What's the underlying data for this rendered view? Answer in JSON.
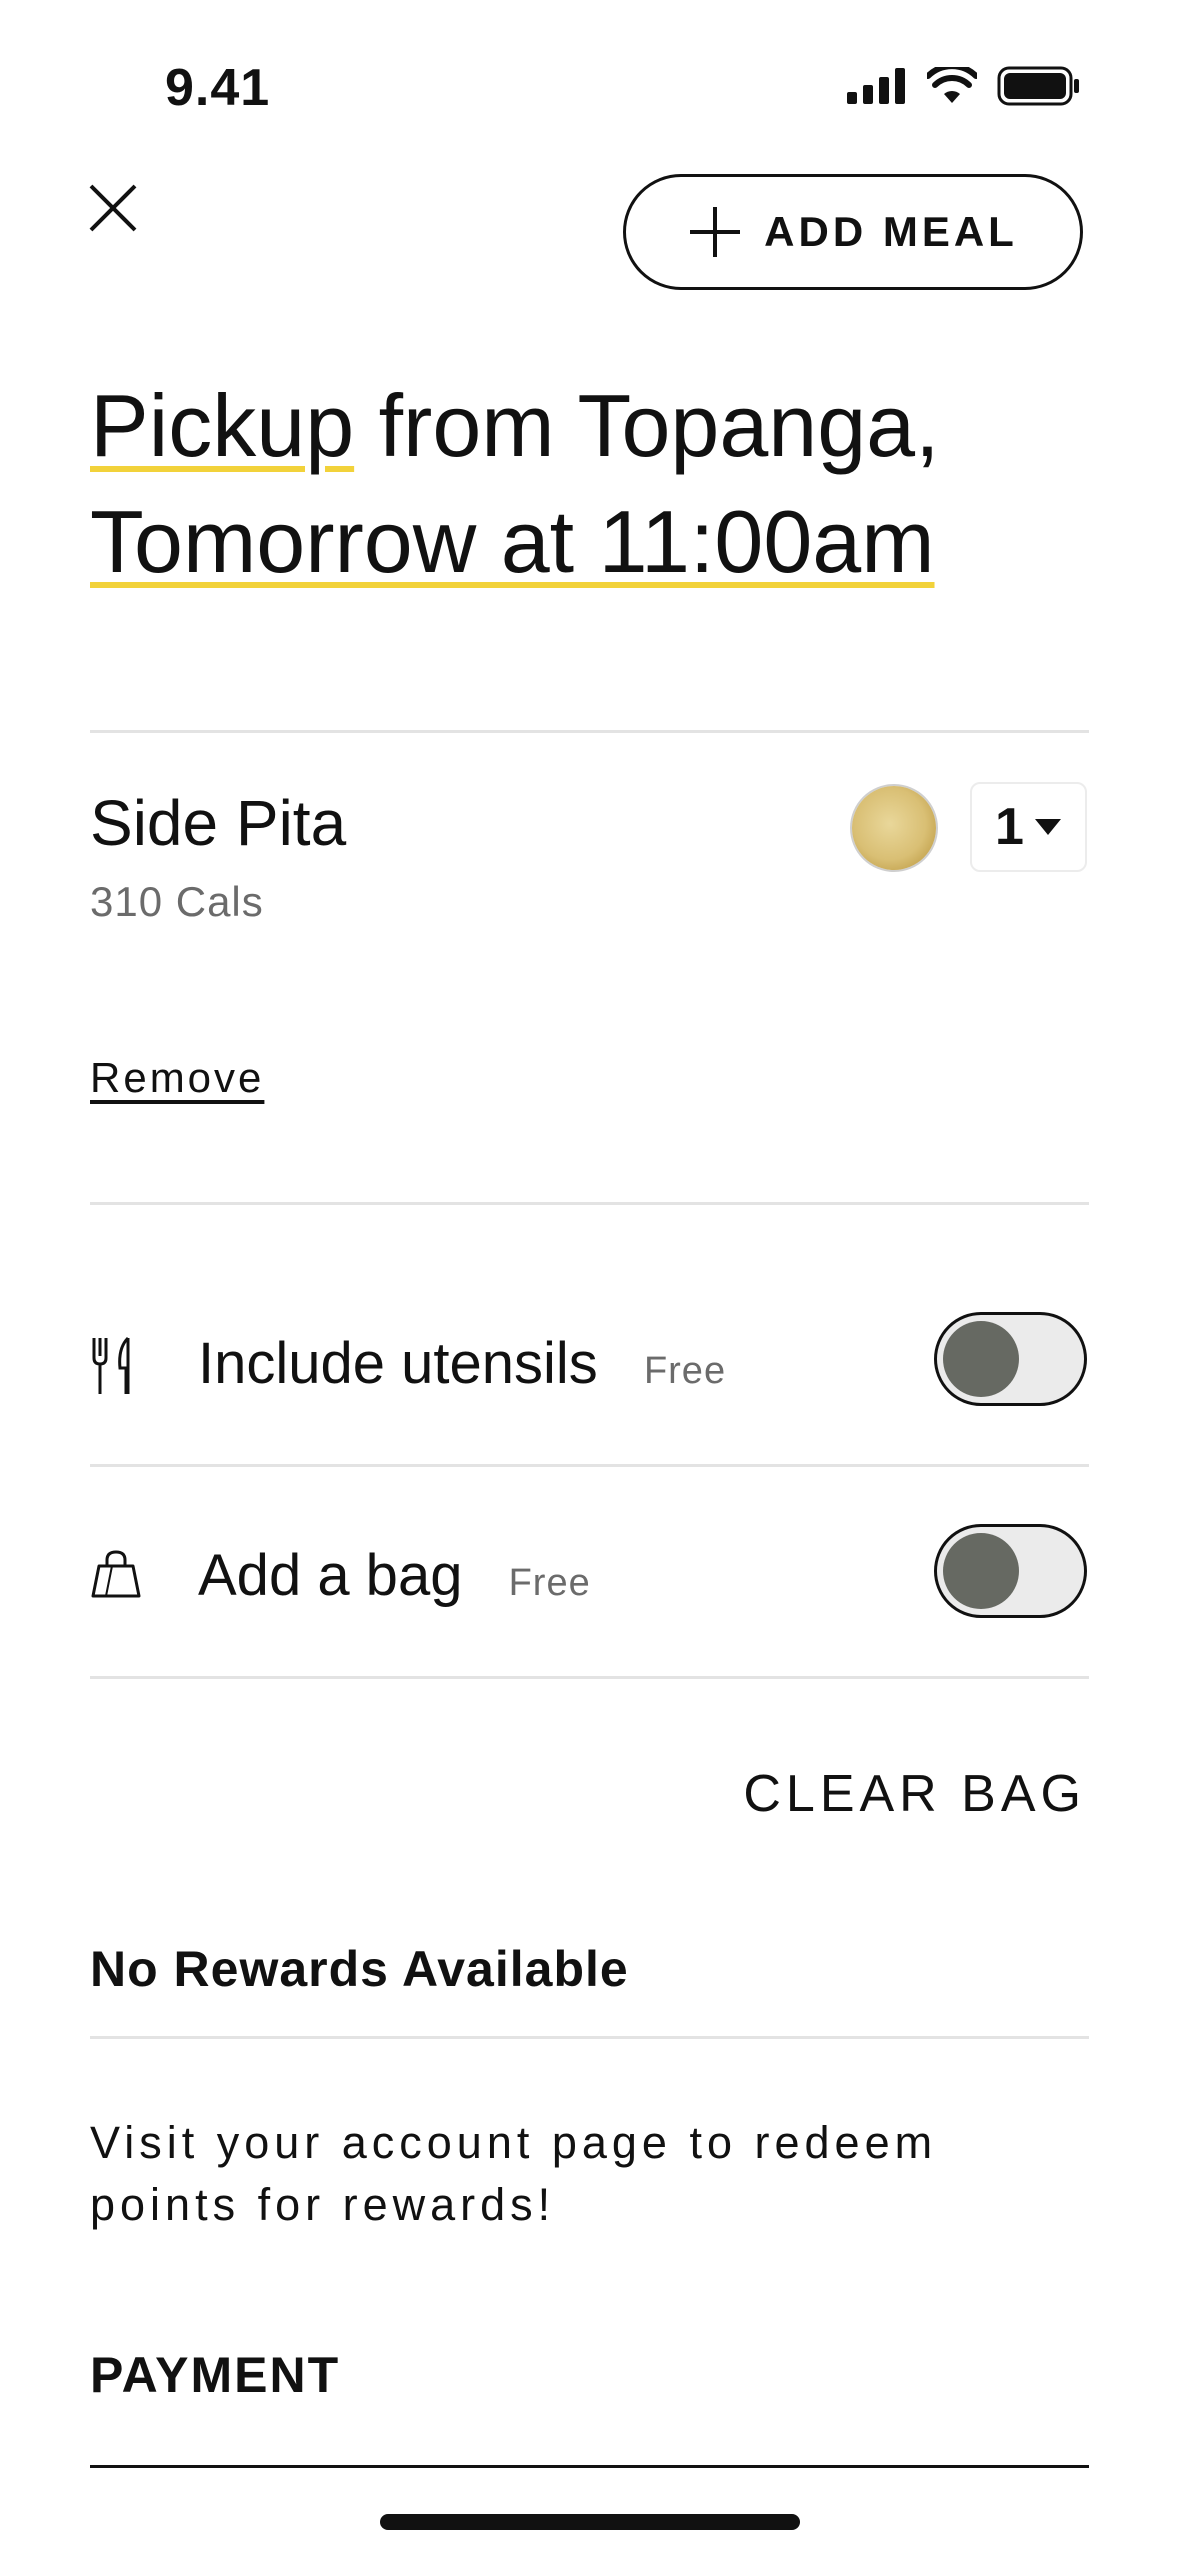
{
  "status_bar": {
    "time": "9.41"
  },
  "header": {
    "add_meal_label": "ADD MEAL"
  },
  "title": {
    "part1_underlined": "Pickup",
    "part2": " from Topanga,",
    "part3_underlined": "Tomorrow at 11:00am"
  },
  "item": {
    "name": "Side Pita",
    "calories": "310 Cals",
    "quantity": "1",
    "remove_label": "Remove"
  },
  "options": [
    {
      "label": "Include utensils",
      "price": "Free",
      "icon": "utensils-icon",
      "enabled": false
    },
    {
      "label": "Add a bag",
      "price": "Free",
      "icon": "bag-icon",
      "enabled": false
    }
  ],
  "clear_bag_label": "CLEAR BAG",
  "rewards": {
    "title": "No Rewards Available",
    "text": "Visit your account page to redeem points for rewards!"
  },
  "payment": {
    "title": "PAYMENT"
  },
  "colors": {
    "accent_underline": "#f2d23a",
    "toggle_knob": "#666962",
    "toggle_track": "#ebebeb"
  }
}
